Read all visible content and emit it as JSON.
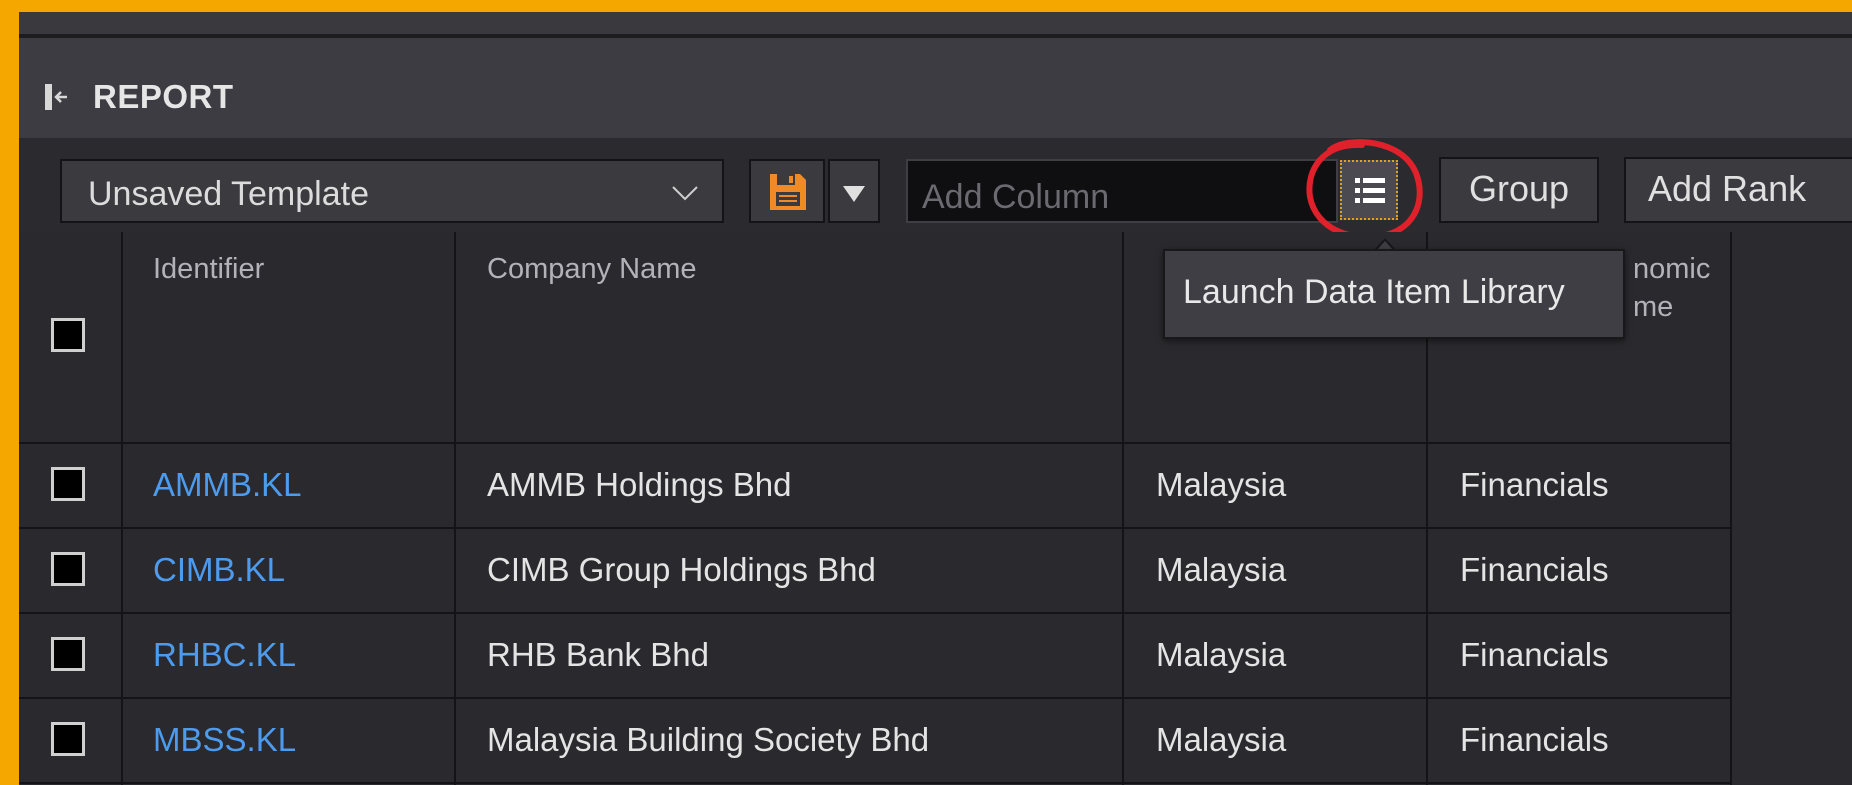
{
  "panel": {
    "title": "REPORT"
  },
  "toolbar": {
    "template_select": "Unsaved Template",
    "add_column_placeholder": "Add Column",
    "group_label": "Group",
    "add_rank_label": "Add Rank",
    "library_tooltip": "Launch Data Item Library",
    "icons": {
      "collapse": "collapse-left-icon",
      "save": "save-icon",
      "dropdown": "caret-down-icon",
      "library": "list-icon",
      "select": "chevron-down-icon"
    },
    "save_icon_color": "#f08a24",
    "highlight_color": "#e0202a"
  },
  "table": {
    "headers": {
      "identifier": "Identifier",
      "company_name": "Company Name",
      "economic_partial_1": "nomic",
      "economic_partial_2": "me"
    },
    "rows": [
      {
        "identifier": "AMMB.KL",
        "company": "AMMB Holdings Bhd",
        "country": "Malaysia",
        "sector": "Financials"
      },
      {
        "identifier": "CIMB.KL",
        "company": "CIMB Group Holdings Bhd",
        "country": "Malaysia",
        "sector": "Financials"
      },
      {
        "identifier": "RHBC.KL",
        "company": "RHB Bank Bhd",
        "country": "Malaysia",
        "sector": "Financials"
      },
      {
        "identifier": "MBSS.KL",
        "company": "Malaysia Building Society Bhd",
        "country": "Malaysia",
        "sector": "Financials"
      }
    ]
  }
}
